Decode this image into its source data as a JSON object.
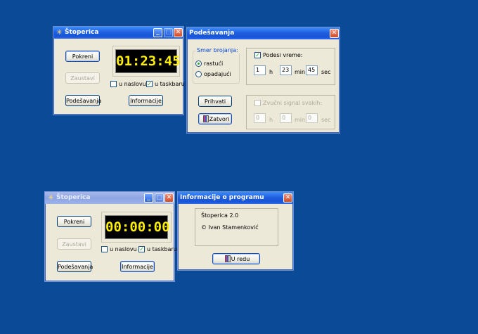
{
  "stopwatch_running": {
    "title": "Štoperica",
    "time": "01:23:45",
    "start_label": "Pokreni",
    "stop_label": "Zaustavi",
    "title_check_label": "u naslovu",
    "title_check_on": false,
    "taskbar_check_label": "u taskbaru",
    "taskbar_check_on": true,
    "settings_label": "Podešavanja",
    "info_label": "Informacije"
  },
  "settings_dialog": {
    "title": "Podešavanja",
    "direction_group": "Smer brojanja:",
    "radio_up": "rastući",
    "radio_down": "opadajući",
    "set_time_label": "Podesi vreme:",
    "set_time_on": true,
    "hours": "1",
    "hours_unit": "h",
    "minutes": "23",
    "minutes_unit": "min",
    "seconds": "45",
    "seconds_unit": "sec",
    "accept_label": "Prihvati",
    "close_label": "Zatvori",
    "sound_label": "Zvučni signal svakih:",
    "sound_on": false,
    "sound_hours": "0",
    "sound_hours_unit": "h",
    "sound_minutes": "0",
    "sound_minutes_unit": "min",
    "sound_seconds": "0",
    "sound_seconds_unit": "sec"
  },
  "stopwatch_idle": {
    "title": "Štoperica",
    "time": "00:00:00",
    "start_label": "Pokreni",
    "stop_label": "Zaustavi",
    "title_check_label": "u naslovu",
    "title_check_on": false,
    "taskbar_check_label": "u taskbaru",
    "taskbar_check_on": true,
    "settings_label": "Podešavanja",
    "info_label": "Informacije"
  },
  "about_dialog": {
    "title": "Informacije o programu",
    "app_name": "Štoperica 2.0",
    "author": "© Ivan Stamenković",
    "ok_label": "U redu"
  },
  "icons": {
    "check_mark": "✓",
    "close": "✕",
    "minimize": "_",
    "maximize": "□",
    "app_icon": "✳"
  },
  "colors": {
    "desktop": "#0a4a96",
    "display_bg": "#000000",
    "display_fg": "#ffef00"
  }
}
